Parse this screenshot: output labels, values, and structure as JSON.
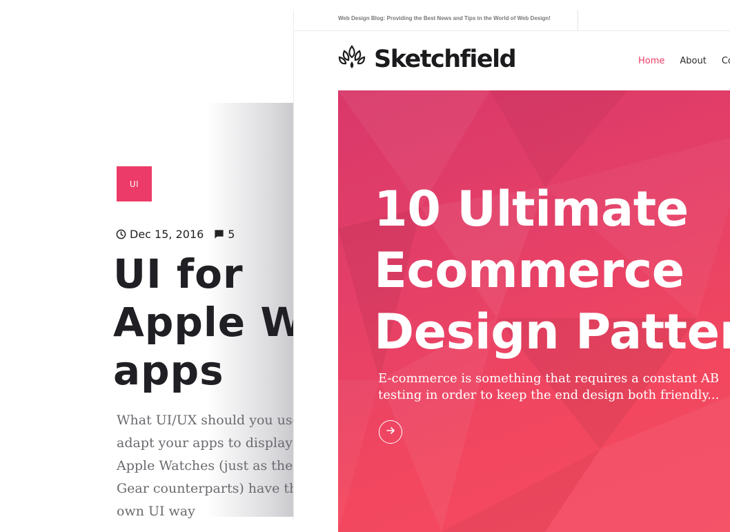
{
  "back_post": {
    "category": "UI",
    "date": "Dec 15, 2016",
    "comments": "5",
    "title_lines": [
      "UI for",
      "Apple Watch",
      "apps"
    ],
    "excerpt": "What UI/UX should you use to adapt your apps to display on Apple Watches (just as their Gear counterparts) have their own UI way"
  },
  "site": {
    "tagline": "Web Design Blog: Providing the Best News and Tips in the World of Web Design!",
    "logo_text": "Sketchfield",
    "nav": [
      {
        "label": "Home",
        "active": true
      },
      {
        "label": "About",
        "active": false
      },
      {
        "label": "Contact",
        "active": false
      }
    ]
  },
  "hero": {
    "title_lines": [
      "10 Ultimate",
      "Ecommerce",
      "Design Patterns"
    ],
    "excerpt": "E-commerce is something that requires a constant AB testing in order to keep the end design both friendly...",
    "more_icon": "arrow-right-icon"
  },
  "colors": {
    "accent": "#ec3b68",
    "hero_gradient_start": "#d9386a",
    "hero_gradient_end": "#f54a60",
    "text_dark": "#1f1f24"
  }
}
